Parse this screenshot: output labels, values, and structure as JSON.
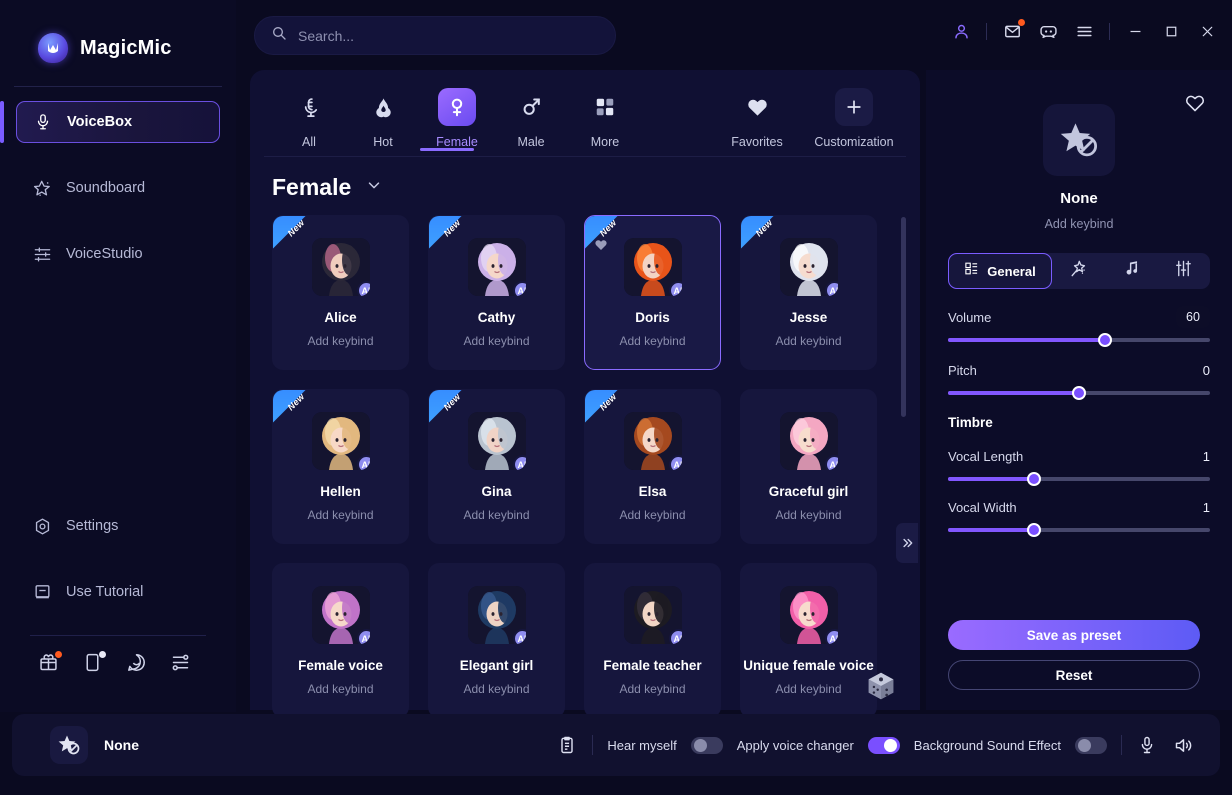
{
  "app": {
    "title": "MagicMic",
    "logo_icon": "magicmic-logo-icon"
  },
  "search": {
    "placeholder": "Search...",
    "value": "",
    "icon": "search-icon"
  },
  "titlebar": {
    "account_icon": "user-account-icon",
    "mail_icon": "mail-envelope-icon",
    "discord_icon": "discord-icon",
    "menu_icon": "hamburger-menu-icon",
    "minimize_icon": "minimize-icon",
    "maximize_icon": "maximize-icon",
    "close_icon": "close-icon"
  },
  "sidebar": {
    "items": [
      {
        "label": "VoiceBox",
        "icon": "microphone-icon",
        "active": true
      },
      {
        "label": "Soundboard",
        "icon": "magic-star-icon",
        "active": false
      },
      {
        "label": "VoiceStudio",
        "icon": "sliders-icon",
        "active": false
      },
      {
        "label": "Settings",
        "icon": "gear-hex-icon",
        "active": false
      },
      {
        "label": "Use Tutorial",
        "icon": "book-icon",
        "active": false
      }
    ],
    "tray": [
      {
        "icon": "gift-box-icon",
        "badge": "orange-dot"
      },
      {
        "icon": "mobile-device-icon",
        "badge": "white-dot"
      },
      {
        "icon": "chat-bubble-icon",
        "badge": ""
      },
      {
        "icon": "share-nodes-icon",
        "badge": ""
      }
    ]
  },
  "categories": [
    {
      "label": "All",
      "icon": "microphone-alt-icon",
      "selected": false
    },
    {
      "label": "Hot",
      "icon": "flame-icon",
      "selected": false
    },
    {
      "label": "Female",
      "icon": "female-venus-icon",
      "selected": true
    },
    {
      "label": "Male",
      "icon": "male-mars-icon",
      "selected": false
    },
    {
      "label": "More",
      "icon": "grid-squares-icon",
      "selected": false
    }
  ],
  "categories_right": [
    {
      "label": "Favorites",
      "icon": "heart-icon"
    },
    {
      "label": "Customization",
      "icon": "plus-icon"
    }
  ],
  "section": {
    "title": "Female",
    "chevron_icon": "chevron-down-icon",
    "collapse_icon": "double-chevron-right-icon",
    "random_icon": "dice-icon"
  },
  "voice_cards": [
    {
      "name": "Alice",
      "keybind": "Add keybind",
      "new": true,
      "selected": false,
      "favorited": false,
      "ai": "AI",
      "hair": "#2b2838",
      "hair2": "#c06a8e",
      "skin": "#f0cdbe"
    },
    {
      "name": "Cathy",
      "keybind": "Add keybind",
      "new": true,
      "selected": false,
      "favorited": false,
      "ai": "AI",
      "hair": "#cbb0e8",
      "hair2": "#e8dcf6",
      "skin": "#f5d7c9"
    },
    {
      "name": "Doris",
      "keybind": "Add keybind",
      "new": true,
      "selected": true,
      "favorited": true,
      "ai": "AI",
      "hair": "#e8541a",
      "hair2": "#ff8a3d",
      "skin": "#f3d3c3"
    },
    {
      "name": "Jesse",
      "keybind": "Add keybind",
      "new": true,
      "selected": false,
      "favorited": false,
      "ai": "AI",
      "hair": "#dfe3ee",
      "hair2": "#ffffff",
      "skin": "#f6dccf"
    },
    {
      "name": "Hellen",
      "keybind": "Add keybind",
      "new": true,
      "selected": false,
      "favorited": false,
      "ai": "AI",
      "hair": "#e2b87f",
      "hair2": "#f6ddae",
      "skin": "#f7d8c6"
    },
    {
      "name": "Gina",
      "keybind": "Add keybind",
      "new": true,
      "selected": false,
      "favorited": false,
      "ai": "AI",
      "hair": "#b9c3cf",
      "hair2": "#e3eaf2",
      "skin": "#f0d3c6"
    },
    {
      "name": "Elsa",
      "keybind": "Add keybind",
      "new": true,
      "selected": false,
      "favorited": false,
      "ai": "AI",
      "hair": "#a5491f",
      "hair2": "#d9793a",
      "skin": "#f5d8c8"
    },
    {
      "name": "Graceful girl",
      "keybind": "Add keybind",
      "new": false,
      "selected": false,
      "favorited": false,
      "ai": "AI",
      "hair": "#f4a7c2",
      "hair2": "#ffd3e2",
      "skin": "#f7dccd"
    },
    {
      "name": "Female voice",
      "keybind": "Add keybind",
      "new": false,
      "selected": false,
      "favorited": false,
      "ai": "AI",
      "hair": "#c073c8",
      "hair2": "#f0a7d8",
      "skin": "#f6d9ca"
    },
    {
      "name": "Elegant girl",
      "keybind": "Add keybind",
      "new": false,
      "selected": false,
      "favorited": false,
      "ai": "AI",
      "hair": "#1e3a63",
      "hair2": "#3a5c92",
      "skin": "#eed3c4"
    },
    {
      "name": "Female teacher",
      "keybind": "Add keybind",
      "new": false,
      "selected": false,
      "favorited": false,
      "ai": "AI",
      "hair": "#1d1b22",
      "hair2": "#37323e",
      "skin": "#f2d6c6"
    },
    {
      "name": "Unique female voice",
      "keybind": "Add keybind",
      "new": false,
      "selected": false,
      "favorited": false,
      "ai": "AI",
      "hair": "#f25fa8",
      "hair2": "#ff9ed0",
      "skin": "#f7dbcd"
    }
  ],
  "inspector": {
    "favorite_icon": "heart-outline-icon",
    "preset_icon": "star-none-icon",
    "preset_name": "None",
    "keybind": "Add keybind",
    "tabs": [
      {
        "label": "General",
        "icon": "grid-list-icon",
        "active": true
      },
      {
        "label": "",
        "icon": "magic-wand-icon",
        "active": false
      },
      {
        "label": "",
        "icon": "music-note-icon",
        "active": false
      },
      {
        "label": "",
        "icon": "equalizer-icon",
        "active": false
      }
    ],
    "sliders": [
      {
        "label": "Volume",
        "value": "60",
        "percent": 60,
        "badge": true
      },
      {
        "label": "Pitch",
        "value": "0",
        "percent": 50,
        "badge": false
      }
    ],
    "timbre_header": "Timbre",
    "timbre_sliders": [
      {
        "label": "Vocal Length",
        "value": "1",
        "percent": 33,
        "badge": false
      },
      {
        "label": "Vocal Width",
        "value": "1",
        "percent": 33,
        "badge": false
      }
    ],
    "save_label": "Save as preset",
    "reset_label": "Reset"
  },
  "statusbar": {
    "preset_icon": "star-none-icon",
    "preset_name": "None",
    "clipboard_icon": "clipboard-icon",
    "hear_myself_label": "Hear myself",
    "hear_myself_on": false,
    "apply_voice_changer_label": "Apply voice changer",
    "apply_voice_changer_on": true,
    "background_sound_label": "Background Sound Effect",
    "background_sound_on": false,
    "mic_icon": "microphone-icon",
    "speaker_icon": "speaker-icon"
  },
  "colors": {
    "accent": "#7a5cff",
    "accent_bright": "#9a6bff",
    "bg": "#0a0a20",
    "panel": "#101033",
    "card": "#16163d",
    "badge_blue": "#2f7bff"
  }
}
